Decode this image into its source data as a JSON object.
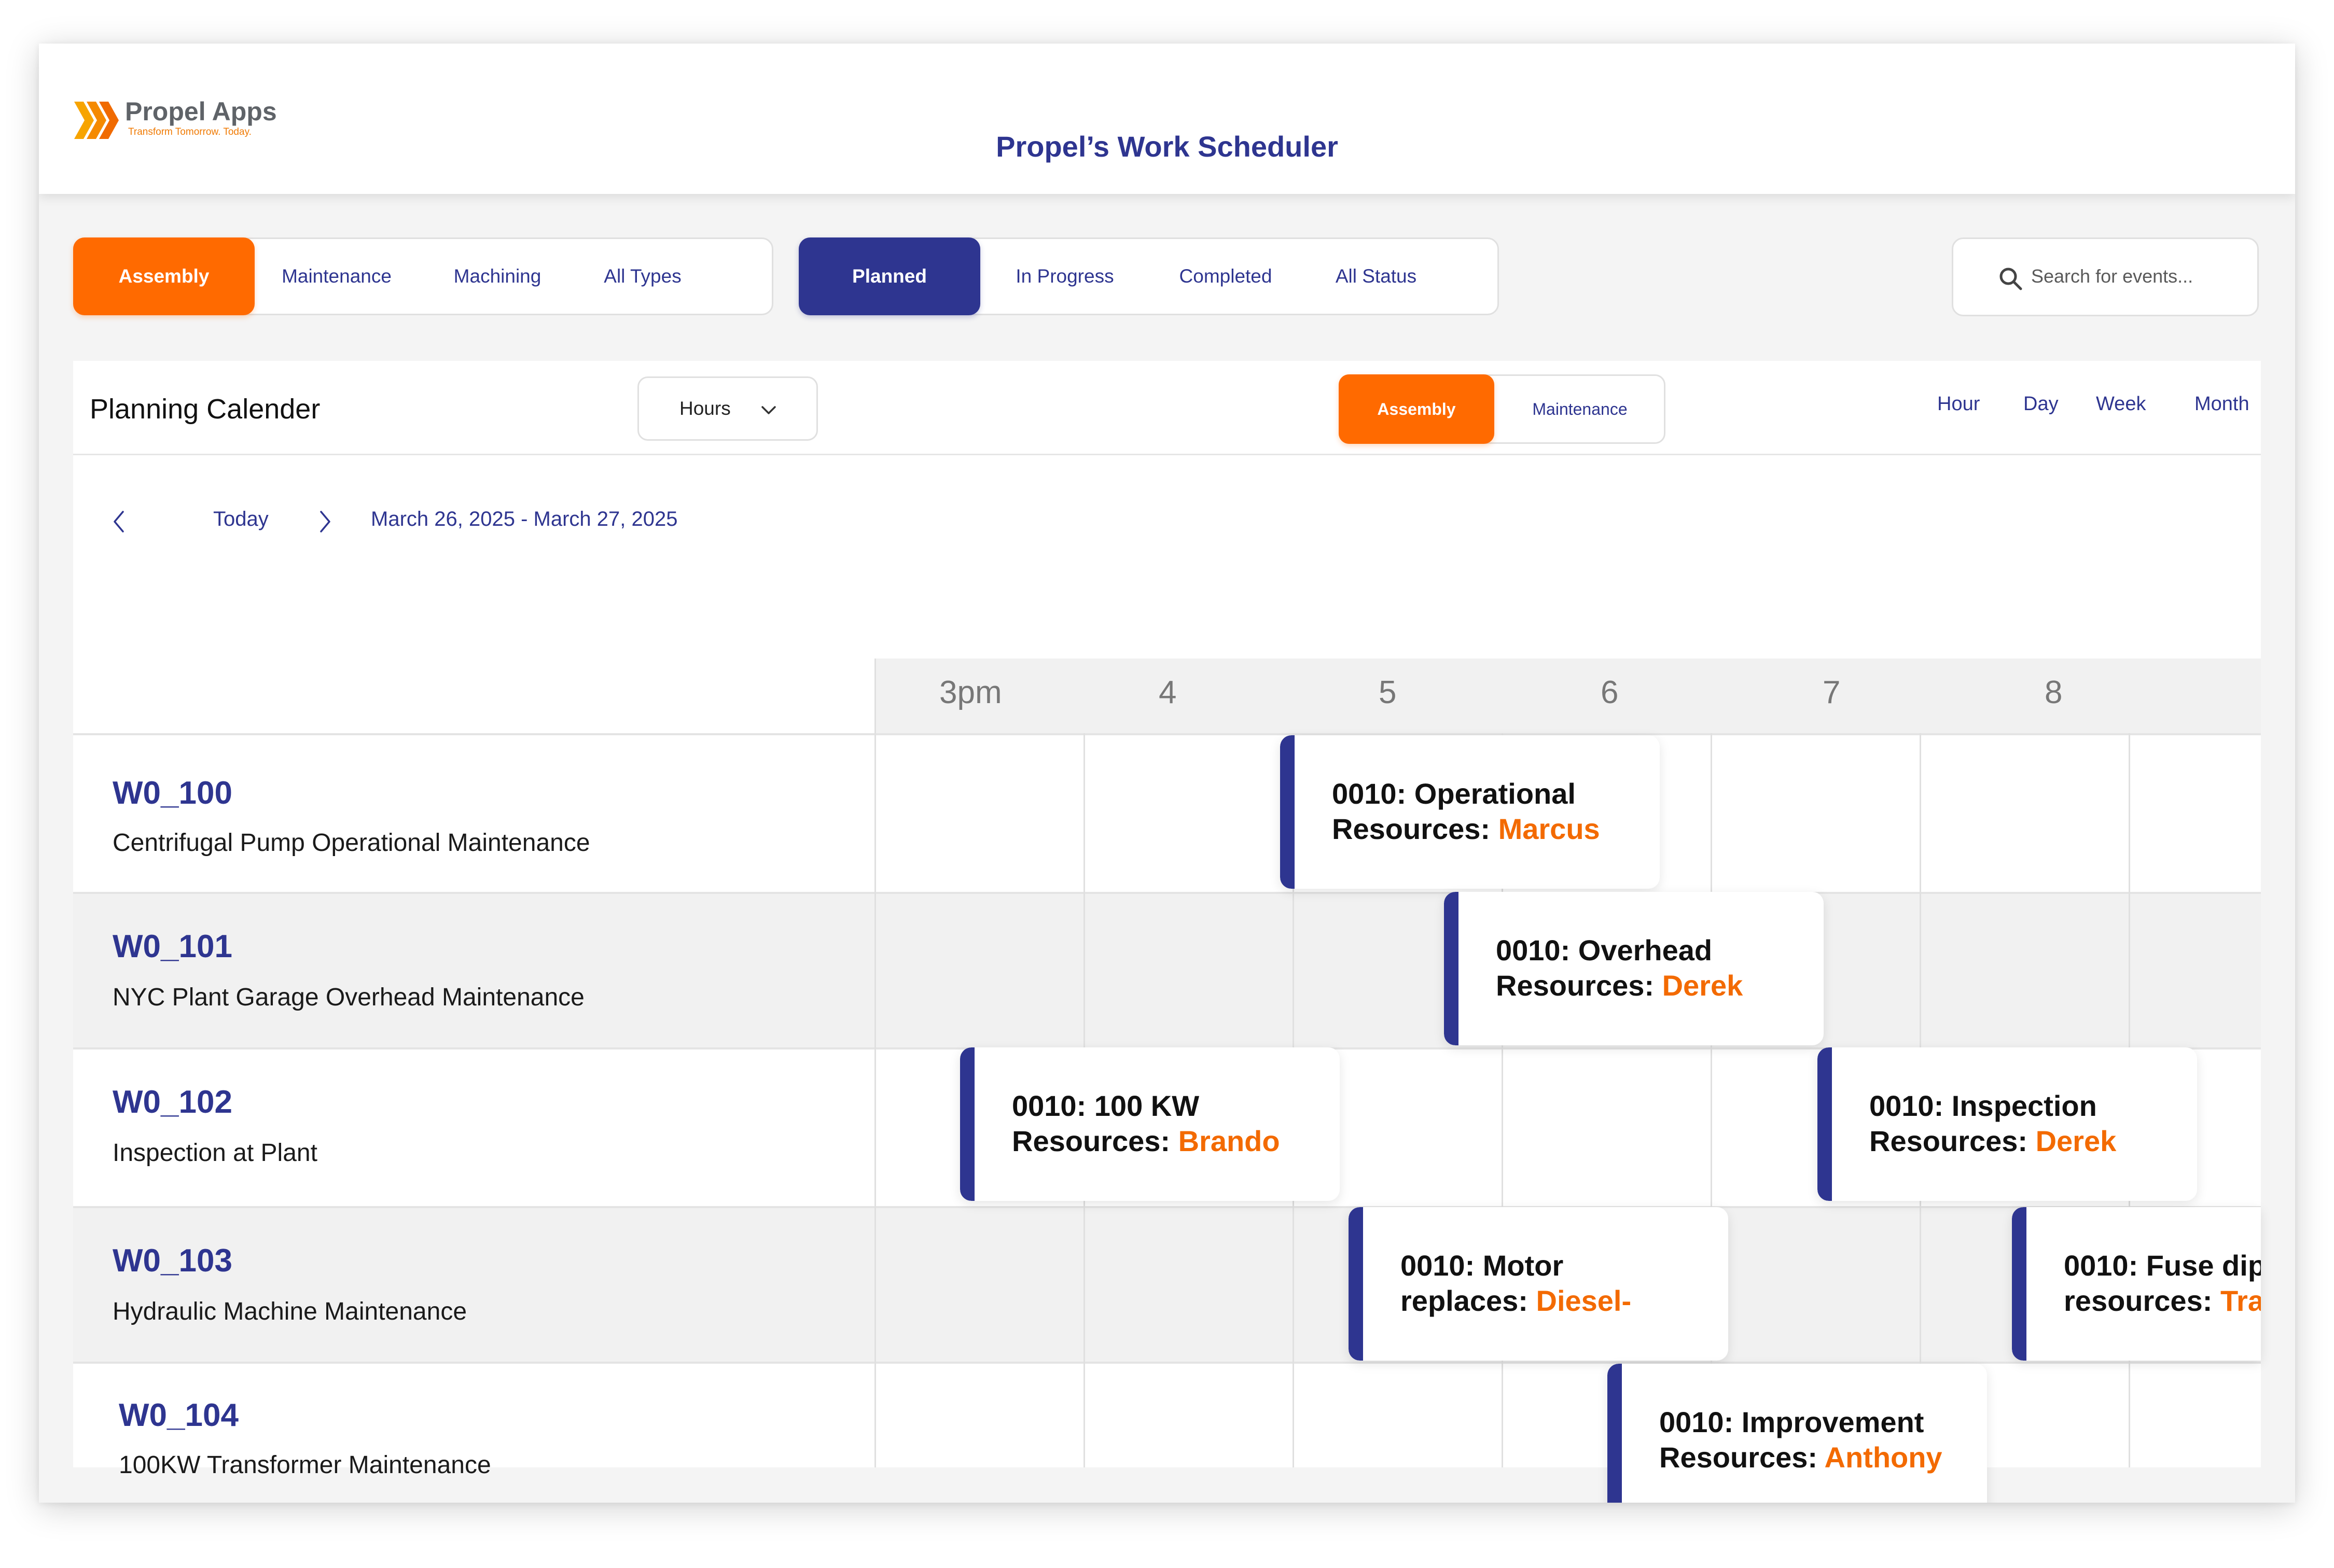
{
  "brand": {
    "name": "Propel Apps",
    "tagline": "Transform Tomorrow. Today.",
    "colors": {
      "navy": "#2e3590",
      "orange": "#ff6a00",
      "accent_text": "#f36a00"
    }
  },
  "header": {
    "title": "Propel’s Work Scheduler"
  },
  "type_filter": {
    "items": [
      {
        "label": "Assembly",
        "active": true
      },
      {
        "label": "Maintenance",
        "active": false
      },
      {
        "label": "Machining",
        "active": false
      },
      {
        "label": "All Types",
        "active": false
      }
    ]
  },
  "status_filter": {
    "items": [
      {
        "label": "Planned",
        "active": true
      },
      {
        "label": "In Progress",
        "active": false
      },
      {
        "label": "Completed",
        "active": false
      },
      {
        "label": "All Status",
        "active": false
      }
    ]
  },
  "search": {
    "placeholder": "Search for events...",
    "icon": "search-icon"
  },
  "calendar": {
    "title": "Planning Calender",
    "scale_select": {
      "value": "Hours",
      "icon": "chevron-down-icon"
    },
    "resource_type_toggle": [
      {
        "label": "Assembly",
        "active": true
      },
      {
        "label": "Maintenance",
        "active": false
      }
    ],
    "views": [
      "Hour",
      "Day",
      "Week",
      "Month"
    ],
    "navigation": {
      "prev_icon": "chevron-left-icon",
      "today_label": "Today",
      "next_icon": "chevron-right-icon",
      "date_range": "March 26, 2025 - March 27, 2025"
    },
    "hours": [
      "3pm",
      "4",
      "5",
      "6",
      "7",
      "8"
    ],
    "work_orders": [
      {
        "id": "W0_100",
        "description": "Centrifugal Pump Operational Maintenance"
      },
      {
        "id": "W0_101",
        "description": "NYC Plant Garage Overhead Maintenance"
      },
      {
        "id": "W0_102",
        "description": "Inspection at Plant"
      },
      {
        "id": "W0_103",
        "description": "Hydraulic Machine Maintenance"
      },
      {
        "id": "W0_104",
        "description": "100KW Transformer Maintenance"
      }
    ],
    "events": [
      {
        "title": "0010: Operational",
        "resource_label": "Resources:",
        "resource": "Marcus"
      },
      {
        "title": "0010: Overhead",
        "resource_label": "Resources:",
        "resource": "Derek"
      },
      {
        "title": "0010: 100 KW",
        "resource_label": "Resources:",
        "resource": "Brando"
      },
      {
        "title": "0010: Inspection",
        "resource_label": "Resources:",
        "resource": "Derek"
      },
      {
        "title": "0010: Motor",
        "resource_label": "replaces:",
        "resource": "Diesel-"
      },
      {
        "title": "0010: Fuse dip",
        "resource_label": "resources:",
        "resource": "Tra"
      },
      {
        "title": "0010: Improvement",
        "resource_label": "Resources:",
        "resource": "Anthony"
      }
    ]
  }
}
